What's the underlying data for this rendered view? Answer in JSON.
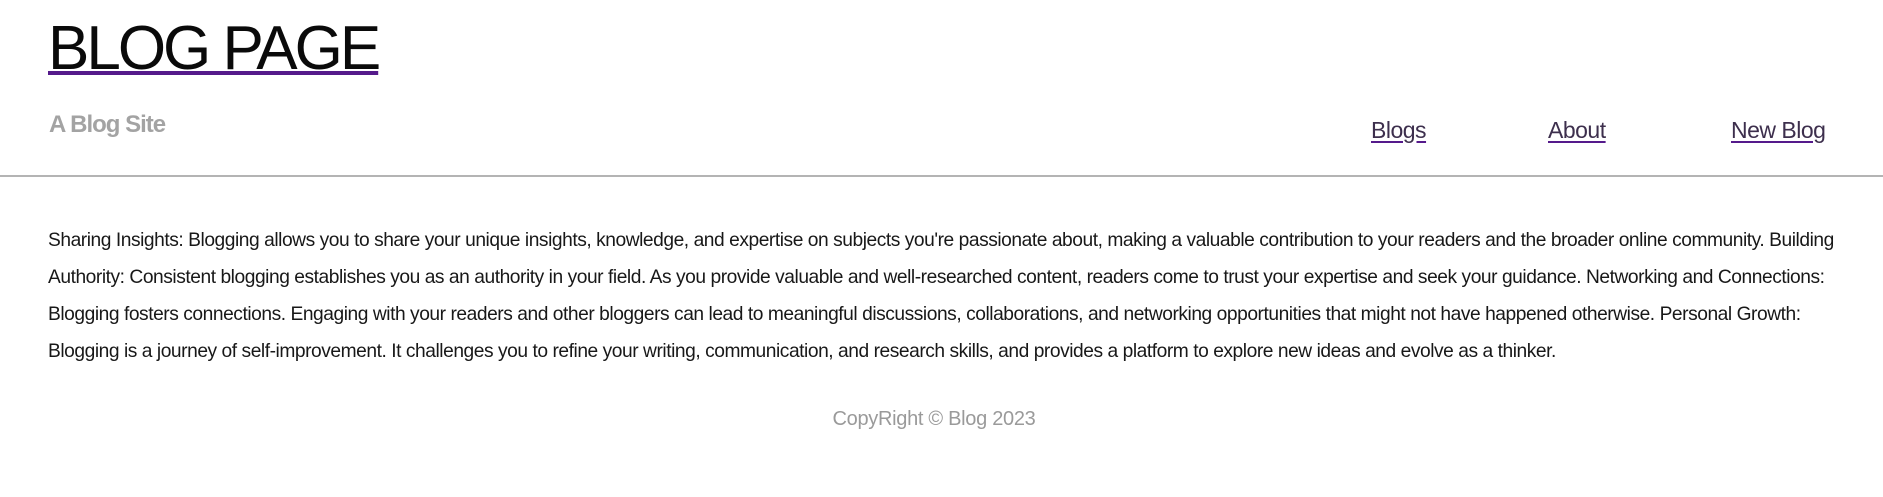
{
  "header": {
    "title": "BLOG PAGE",
    "tagline": "A Blog Site"
  },
  "nav": {
    "items": [
      {
        "label": "Blogs"
      },
      {
        "label": "About"
      },
      {
        "label": "New Blog"
      }
    ]
  },
  "main": {
    "body_text": "Sharing Insights: Blogging allows you to share your unique insights, knowledge, and expertise on subjects you're passionate about, making a valuable contribution to your readers and the broader online community. Building Authority: Consistent blogging establishes you as an authority in your field. As you provide valuable and well-researched content, readers come to trust your expertise and seek your guidance. Networking and Connections: Blogging fosters connections. Engaging with your readers and other bloggers can lead to meaningful discussions, collaborations, and networking opportunities that might not have happened otherwise. Personal Growth: Blogging is a journey of self-improvement. It challenges you to refine your writing, communication, and research skills, and provides a platform to explore new ideas and evolve as a thinker."
  },
  "footer": {
    "copyright": "CopyRight © Blog 2023"
  },
  "colors": {
    "link_underline": "#551a8b",
    "divider": "#b4b4b4",
    "muted_text": "#a3a3a3"
  }
}
